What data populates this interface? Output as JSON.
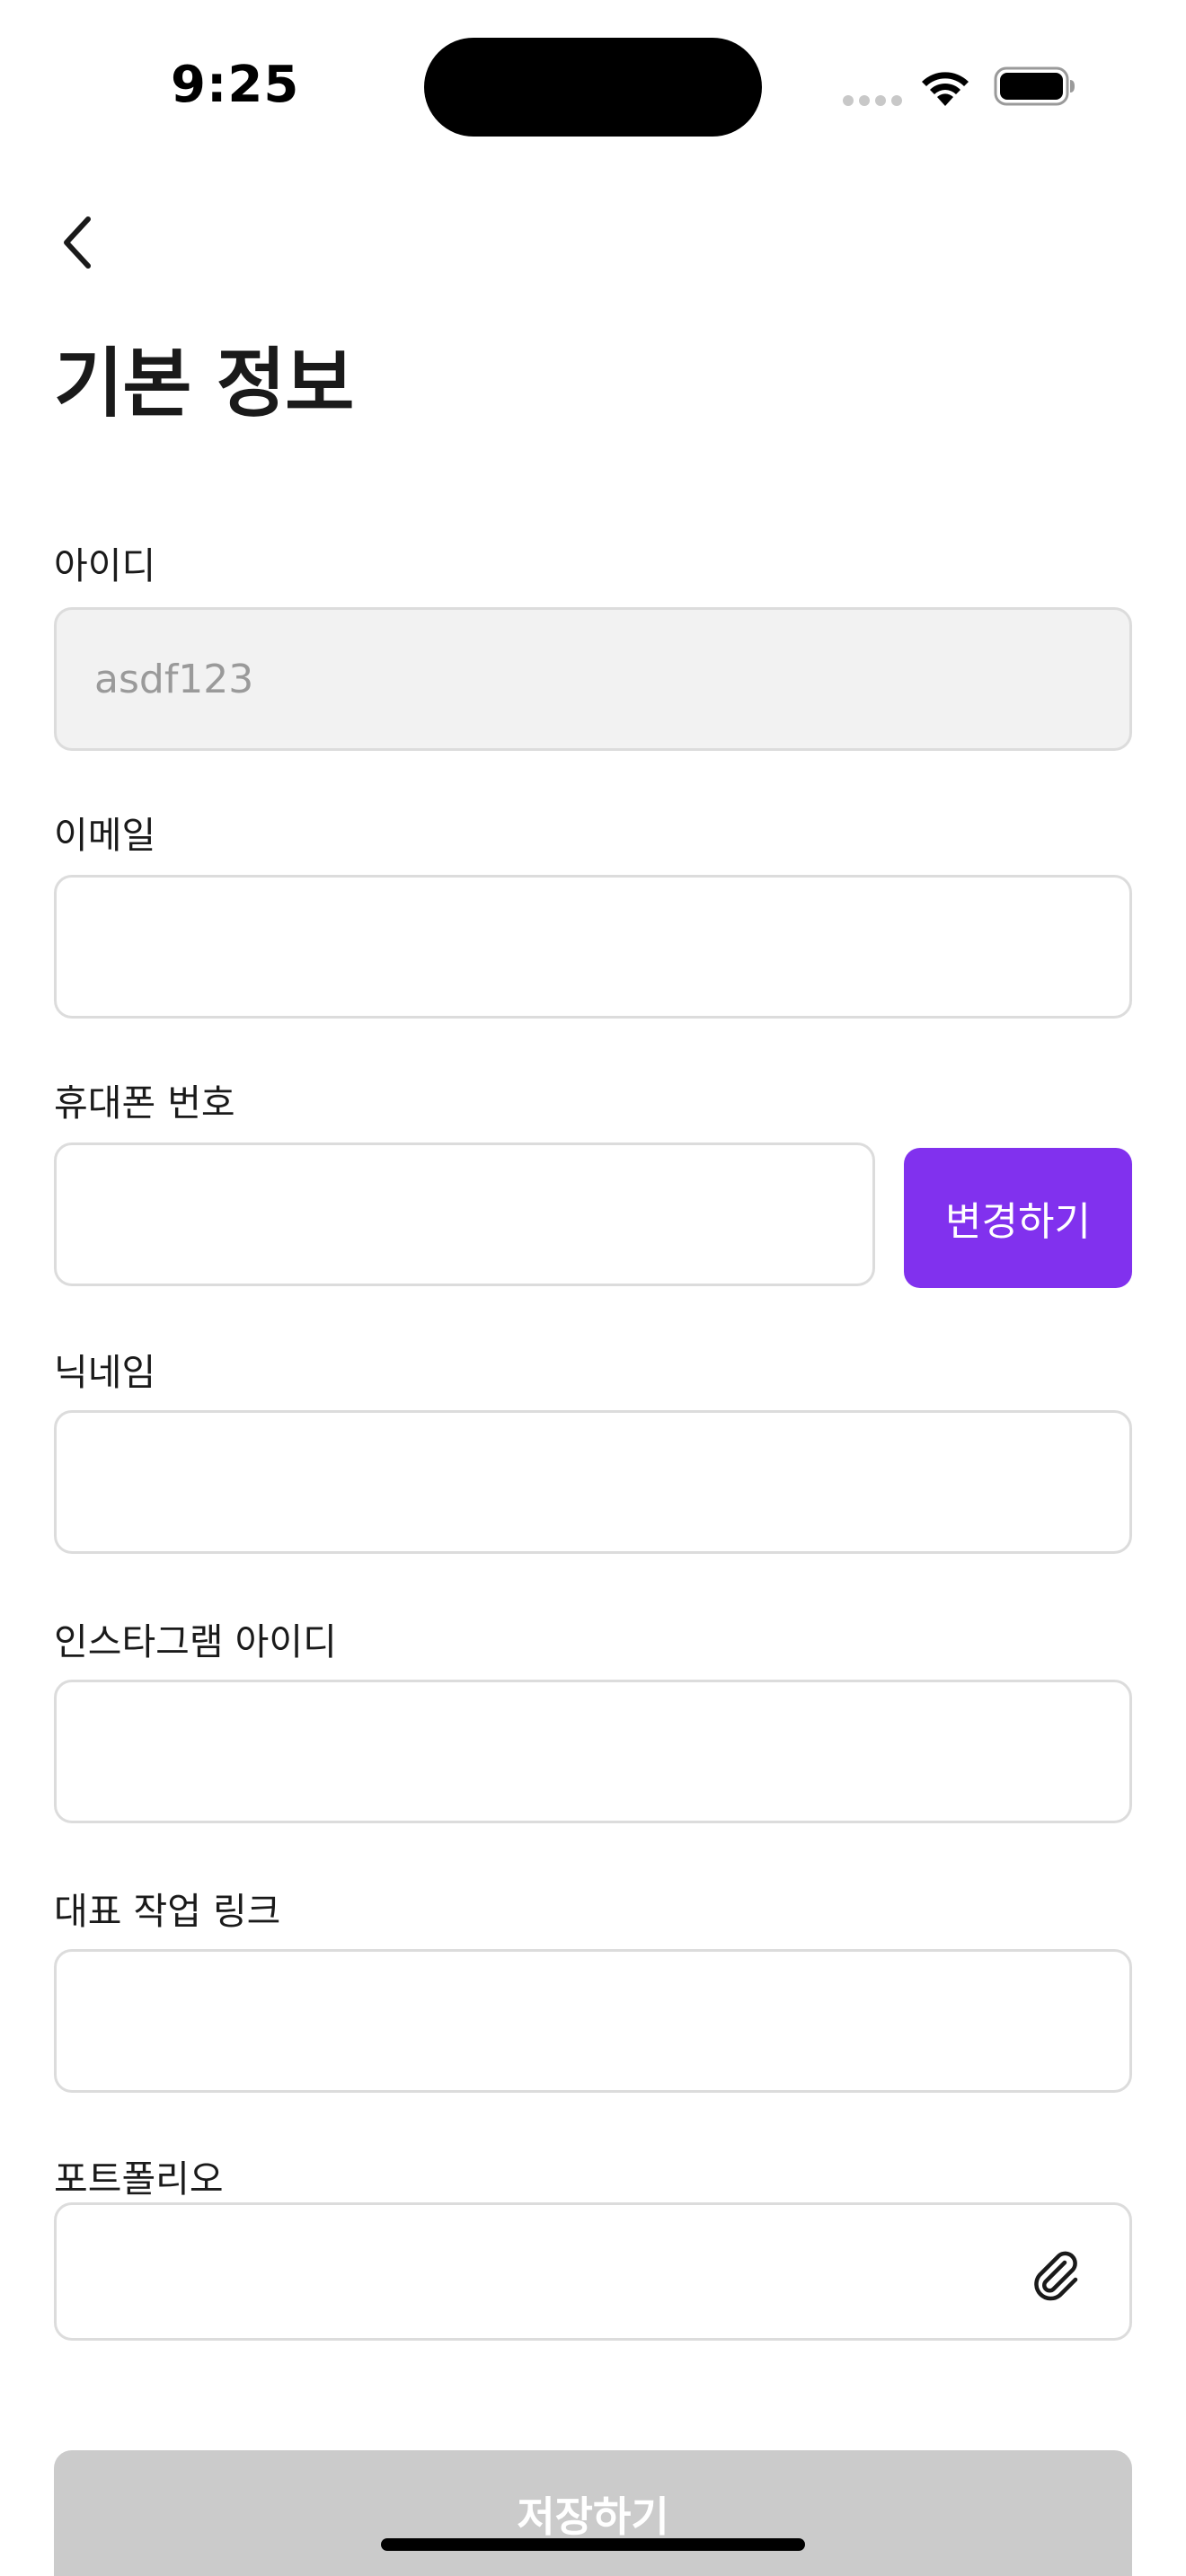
{
  "status_bar": {
    "time": "9:25"
  },
  "header": {
    "back_icon": "chevron-left-icon",
    "title": "기본 정보"
  },
  "form": {
    "id": {
      "label": "아이디",
      "value": "asdf123"
    },
    "email": {
      "label": "이메일",
      "value": ""
    },
    "phone": {
      "label": "휴대폰 번호",
      "value": "",
      "button_label": "변경하기"
    },
    "nickname": {
      "label": "닉네임",
      "value": ""
    },
    "instagram": {
      "label": "인스타그램 아이디",
      "value": ""
    },
    "work_link": {
      "label": "대표 작업 링크",
      "value": ""
    },
    "portfolio": {
      "label": "포트폴리오",
      "value": "",
      "icon": "paperclip-icon"
    }
  },
  "footer": {
    "save_label": "저장하기"
  },
  "colors": {
    "accent": "#8131ee",
    "disabled_button": "#cbcbcb",
    "disabled_field": "#f2f2f2",
    "border": "#dcdcdc"
  }
}
